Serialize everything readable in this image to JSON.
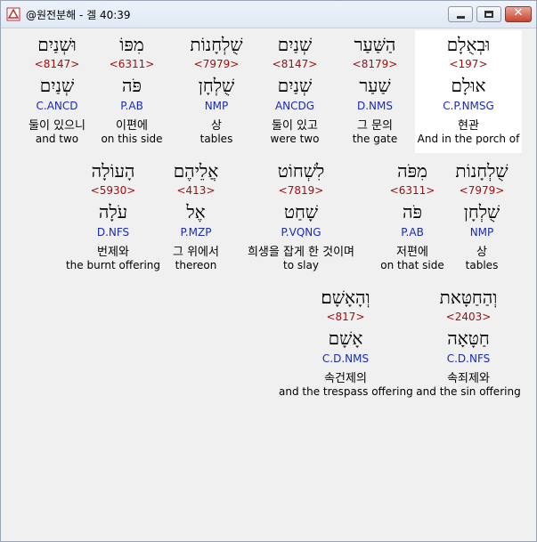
{
  "window": {
    "title": "@원전분해 - 겔 40:39",
    "buttons": {
      "close_label": "✕"
    }
  },
  "rows": [
    [
      {
        "heb1": "וּבְאֻלָם",
        "strong": "<197>",
        "heb2": "אוּלָם",
        "morph": "C.P.NMSG",
        "kor": "현관",
        "eng": "And in the porch of",
        "selected": true
      },
      {
        "heb1": "הַשַּׁעַר",
        "strong": "<8179>",
        "heb2": "שַׁעַר",
        "morph": "D.NMS",
        "kor": "그 문의",
        "eng": "the gate",
        "selected": false
      },
      {
        "heb1": "שְׁנַיִם",
        "strong": "<8147>",
        "heb2": "שְׁנַיִם",
        "morph": "ANCDG",
        "kor": "둘이 있고",
        "eng": "were two",
        "selected": false
      },
      {
        "heb1": "שֻׁלְחָנוֹת",
        "strong": "<7979>",
        "heb2": "שֻׁלְחָן",
        "morph": "NMP",
        "kor": "상",
        "eng": "tables",
        "selected": false
      },
      {
        "heb1": "מִפּוֹ",
        "strong": "<6311>",
        "heb2": "פֹּה",
        "morph": "P.AB",
        "kor": "이편에",
        "eng": "on this side",
        "selected": false
      },
      {
        "heb1": "וּשְׁנַיִם",
        "strong": "<8147>",
        "heb2": "שְׁנַיִם",
        "morph": "C.ANCD",
        "kor": "둘이 있으니",
        "eng": "and two",
        "selected": false
      }
    ],
    [
      {
        "heb1": "שֻׁלְחָנוֹת",
        "strong": "<7979>",
        "heb2": "שֻׁלְחָן",
        "morph": "NMP",
        "kor": "상",
        "eng": "tables",
        "selected": false
      },
      {
        "heb1": "מִפֹּה",
        "strong": "<6311>",
        "heb2": "פֹּה",
        "morph": "P.AB",
        "kor": "저편에",
        "eng": "on that side",
        "selected": false
      },
      {
        "heb1": "לִשְׁחוֹט",
        "strong": "<7819>",
        "heb2": "שָׁחַט",
        "morph": "P.VQNG",
        "kor": "희생을 잡게 한 것이며",
        "eng": "to slay",
        "selected": false
      },
      {
        "heb1": "אֲלֵיהֶם",
        "strong": "<413>",
        "heb2": "אֶל",
        "morph": "P.MZP",
        "kor": "그 위에서",
        "eng": "thereon",
        "selected": false
      },
      {
        "heb1": "הָעוֹלָה",
        "strong": "<5930>",
        "heb2": "עֹלָה",
        "morph": "D.NFS",
        "kor": "번제와",
        "eng": "the burnt offering",
        "selected": false
      }
    ],
    [
      {
        "heb1": "וְהַחַטָּאת",
        "strong": "<2403>",
        "heb2": "חַטָּאָה",
        "morph": "C.D.NFS",
        "kor": "속죄제와",
        "eng": "and the sin offering",
        "selected": false
      },
      {
        "heb1": "וְהָאָשָׁם׃",
        "strong": "<817>",
        "heb2": "אָשָׁם",
        "morph": "C.D.NMS",
        "kor": "속건제의",
        "eng": "and the trespass offering",
        "selected": false
      }
    ]
  ]
}
